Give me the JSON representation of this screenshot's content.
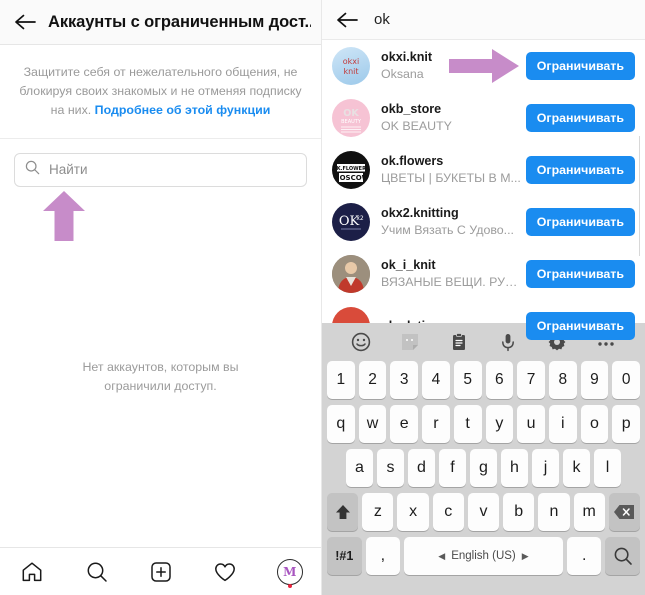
{
  "left_panel": {
    "appbar": {
      "back_icon": "back-arrow-icon",
      "title": "Аккаунты с ограниченным дост..."
    },
    "intro": {
      "text": "Защитите себя от нежелательного общения, не блокируя своих знакомых и не отменяя подписку на них. ",
      "link": "Подробнее об этой функции"
    },
    "search": {
      "icon": "search-icon",
      "placeholder": "Найти",
      "value": ""
    },
    "annotation_arrow": {
      "name": "purple-arrow-up-annotation",
      "color": "#c78cc9"
    },
    "empty_state": "Нет аккаунтов, которым вы ограничили доступ.",
    "tabbar": [
      {
        "name": "home-icon",
        "label": "Home"
      },
      {
        "name": "search-icon",
        "label": "Search"
      },
      {
        "name": "add-post-icon",
        "label": "Add"
      },
      {
        "name": "heart-icon",
        "label": "Activity"
      },
      {
        "name": "profile-avatar",
        "label": "M"
      }
    ]
  },
  "right_panel": {
    "appbar": {
      "back_icon": "back-arrow-icon",
      "query": "ok"
    },
    "annotation_arrow": {
      "name": "purple-arrow-right-annotation",
      "color": "#c78cc9"
    },
    "button_label": "Ограничивать",
    "button_color": "#1a8cf0",
    "results": [
      {
        "username": "okxi.knit",
        "fullname": "Oksana",
        "avatar": "okxi-knit-avatar",
        "action": "Ограничивать"
      },
      {
        "username": "okb_store",
        "fullname": "OK BEAUTY",
        "avatar": "okb-store-avatar",
        "action": "Ограничивать"
      },
      {
        "username": "ok.flowers",
        "fullname": "ЦВЕТЫ | БУКЕТЫ В М...",
        "avatar": "ok-flowers-avatar",
        "action": "Ограничивать"
      },
      {
        "username": "okx2.knitting",
        "fullname": "Учим Вязать С Удово...",
        "avatar": "okx2-knitting-avatar",
        "action": "Ограничивать"
      },
      {
        "username": "ok_i_knit",
        "fullname": "ВЯЗАНЫЕ ВЕЩИ. РУЧ...",
        "avatar": "ok-i-knit-avatar",
        "action": "Ограничивать"
      },
      {
        "username": "ok_deti",
        "fullname": "",
        "avatar": "ok-deti-avatar",
        "action": "Ограничивать"
      }
    ],
    "keyboard": {
      "toolbar": [
        {
          "name": "emoji-icon"
        },
        {
          "name": "sticker-icon"
        },
        {
          "name": "clipboard-icon"
        },
        {
          "name": "microphone-icon"
        },
        {
          "name": "settings-gear-icon",
          "badge": true
        },
        {
          "name": "more-options-icon",
          "badge": true
        }
      ],
      "row_numbers": [
        "1",
        "2",
        "3",
        "4",
        "5",
        "6",
        "7",
        "8",
        "9",
        "0"
      ],
      "row_top": [
        "q",
        "w",
        "e",
        "r",
        "t",
        "y",
        "u",
        "i",
        "o",
        "p"
      ],
      "row_home": [
        "a",
        "s",
        "d",
        "f",
        "g",
        "h",
        "j",
        "k",
        "l"
      ],
      "row_bottom": [
        "z",
        "x",
        "c",
        "v",
        "b",
        "n",
        "m"
      ],
      "shift_key": "shift-icon",
      "backspace_key": "backspace-icon",
      "symbols_key": "!#1",
      "comma_key": ",",
      "space_key": "English (US)",
      "space_left_arrow": "◀",
      "space_right_arrow": "▶",
      "period_key": ".",
      "search_key": "search-icon"
    }
  }
}
